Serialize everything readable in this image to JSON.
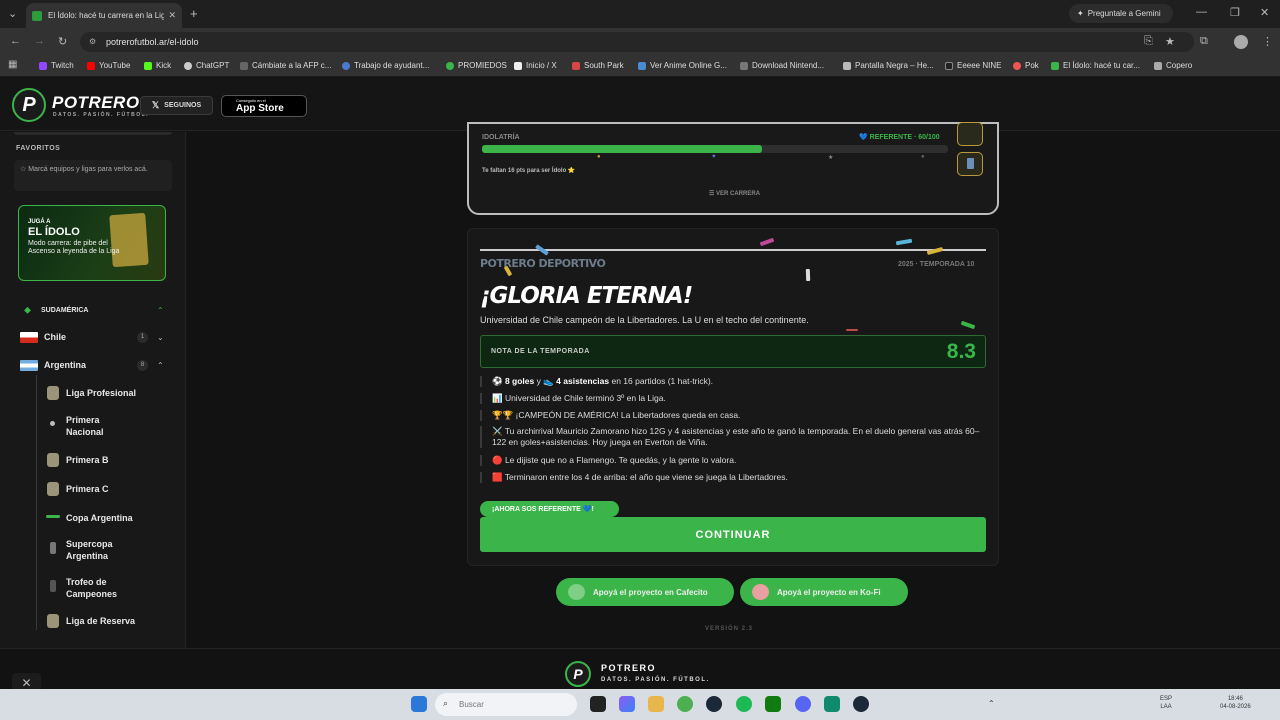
{
  "browser": {
    "tab_title": "El Ídolo: hacé tu carrera en la Lig",
    "gemini_label": "Preguntale a Gemini",
    "url": "potrerofutbol.ar/el-idolo",
    "bookmarks": [
      "Twitch",
      "YouTube",
      "Kick",
      "ChatGPT",
      "Cámbiate a la AFP c...",
      "Trabajo de ayudant...",
      "PROMIEDOS",
      "Inicio / X",
      "South Park",
      "Ver Anime Online G...",
      "Download Nintend...",
      "Pantalla Negra – He...",
      "Eeeee NINE",
      "Pok",
      "El Ídolo: hacé tu car...",
      "Copero"
    ]
  },
  "header": {
    "brand": "POTRERO",
    "tagline": "DATOS. PASIÓN. FÚTBOL.",
    "follow_label": "SEGUINOS",
    "appstore_small": "Conseguilo en el",
    "appstore_big": "App Store"
  },
  "sidebar": {
    "favorites_heading": "FAVORITOS",
    "favorites_hint": "☆ Marcá equipos y ligas para verlos acá.",
    "promo": {
      "line1": "JUGÁ A",
      "line2": "EL ÍDOLO",
      "line3": "Modo carrera: de pibe del Ascenso a leyenda de la Liga"
    },
    "region": "SUDAMÉRICA",
    "countries": [
      {
        "name": "Chile",
        "count": "1"
      },
      {
        "name": "Argentina",
        "count": "8"
      }
    ],
    "leagues": [
      "Liga Profesional",
      "Primera Nacional",
      "Primera B",
      "Primera C",
      "Copa Argentina",
      "Supercopa Argentina",
      "Trofeo de Campeones",
      "Liga de Reserva"
    ]
  },
  "idolatria": {
    "label": "IDOLATRÍA",
    "status": "💙 REFERENTE · 60/100",
    "progress": 0.6,
    "hint": "Te faltan 16 pts para ser Ídolo ⭐",
    "ver_carrera": "☰ VER CARRERA"
  },
  "season": {
    "newspaper": "POTRERO DEPORTIVO",
    "season_label": "2025 · TEMPORADA 10",
    "title": "¡GLORIA ETERNA!",
    "subtitle": "Universidad de Chile campeón de la Libertadores. La U en el techo del continente.",
    "nota_label": "NOTA DE LA TEMPORADA",
    "nota_value": "8.3",
    "events": [
      {
        "pre": "⚽ ",
        "b1": "8 goles",
        "mid": " y 👟 ",
        "b2": "4 asistencias",
        "post": " en 16 partidos (1 hat-trick)."
      },
      {
        "pre": "📊 Universidad de Chile terminó 3º en la Liga.",
        "b1": "",
        "mid": "",
        "b2": "",
        "post": ""
      },
      {
        "pre": "🏆🏆 ¡CAMPEÓN DE AMÉRICA! La Libertadores queda en casa.",
        "b1": "",
        "mid": "",
        "b2": "",
        "post": ""
      },
      {
        "pre": "⚔️ Tu archirrival Mauricio Zamorano hizo 12G y 4 asistencias y este año te ganó la temporada. En el duelo general vas atrás 60–122 en goles+asistencias. Hoy juega en Everton de Viña.",
        "b1": "",
        "mid": "",
        "b2": "",
        "post": ""
      },
      {
        "pre": "🔴 Le dijiste que no a Flamengo. Te quedás, y la gente lo valora.",
        "b1": "",
        "mid": "",
        "b2": "",
        "post": ""
      },
      {
        "pre": "🟥 Terminaron entre los 4 de arriba: el año que viene se juega la Libertadores.",
        "b1": "",
        "mid": "",
        "b2": "",
        "post": ""
      }
    ],
    "badge": "¡AHORA SOS REFERENTE 💙!",
    "continue_label": "CONTINUAR"
  },
  "support": {
    "cafecito": "Apoyá el proyecto en Cafecito",
    "kofi": "Apoyá el proyecto en Ko-Fi",
    "version": "VERSIÓN 2.3"
  },
  "footer": {
    "brand": "POTRERO",
    "tagline": "DATOS. PASIÓN. FÚTBOL."
  },
  "taskbar": {
    "search_placeholder": "Buscar",
    "lang1": "ESP",
    "lang2": "LAA",
    "time": "18:46",
    "date": "04-08-2026"
  },
  "colors": {
    "accent": "#3bb54a",
    "background": "#121212",
    "card": "#181818"
  }
}
